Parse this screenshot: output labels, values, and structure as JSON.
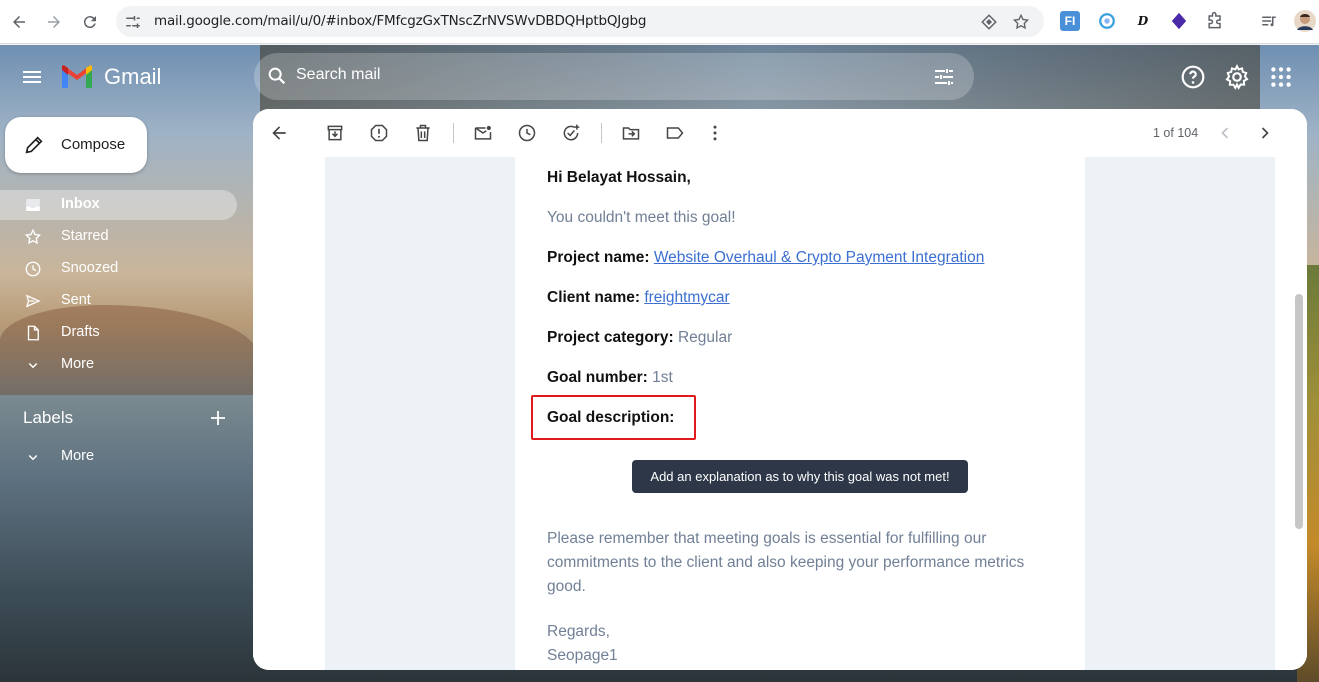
{
  "browser": {
    "url": "mail.google.com/mail/u/0/#inbox/FMfcgzGxTNscZrNVSWvDBDQHptbQJgbg"
  },
  "gmail": {
    "app_name": "Gmail",
    "search_placeholder": "Search mail",
    "compose_label": "Compose",
    "nav": [
      {
        "label": "Inbox",
        "icon": "inbox-icon"
      },
      {
        "label": "Starred",
        "icon": "star-icon"
      },
      {
        "label": "Snoozed",
        "icon": "clock-icon"
      },
      {
        "label": "Sent",
        "icon": "send-icon"
      },
      {
        "label": "Drafts",
        "icon": "draft-icon"
      },
      {
        "label": "More",
        "icon": "chevron-down-icon"
      }
    ],
    "labels_title": "Labels",
    "labels_more": "More",
    "pager": "1 of 104"
  },
  "email": {
    "greeting": "Hi Belayat Hossain,",
    "intro": "You couldn't meet this goal!",
    "project_name_label": "Project name:",
    "project_name_value": "Website Overhaul & Crypto Payment Integration",
    "client_name_label": "Client name:",
    "client_name_value": "freightmycar",
    "project_category_label": "Project category:",
    "project_category_value": "Regular",
    "goal_number_label": "Goal number:",
    "goal_number_value": "1st",
    "goal_description_label": "Goal description:",
    "cta_label": "Add an explanation as to why this goal was not met!",
    "reminder": "Please remember that meeting goals is essential for fulfilling our commitments to the client and also keeping your performance metrics good.",
    "regards": "Regards,",
    "signature": "Seopage1"
  },
  "colors": {
    "highlight": "#e01a1a",
    "link": "#3b6fd1",
    "button_bg": "#2d3748"
  }
}
